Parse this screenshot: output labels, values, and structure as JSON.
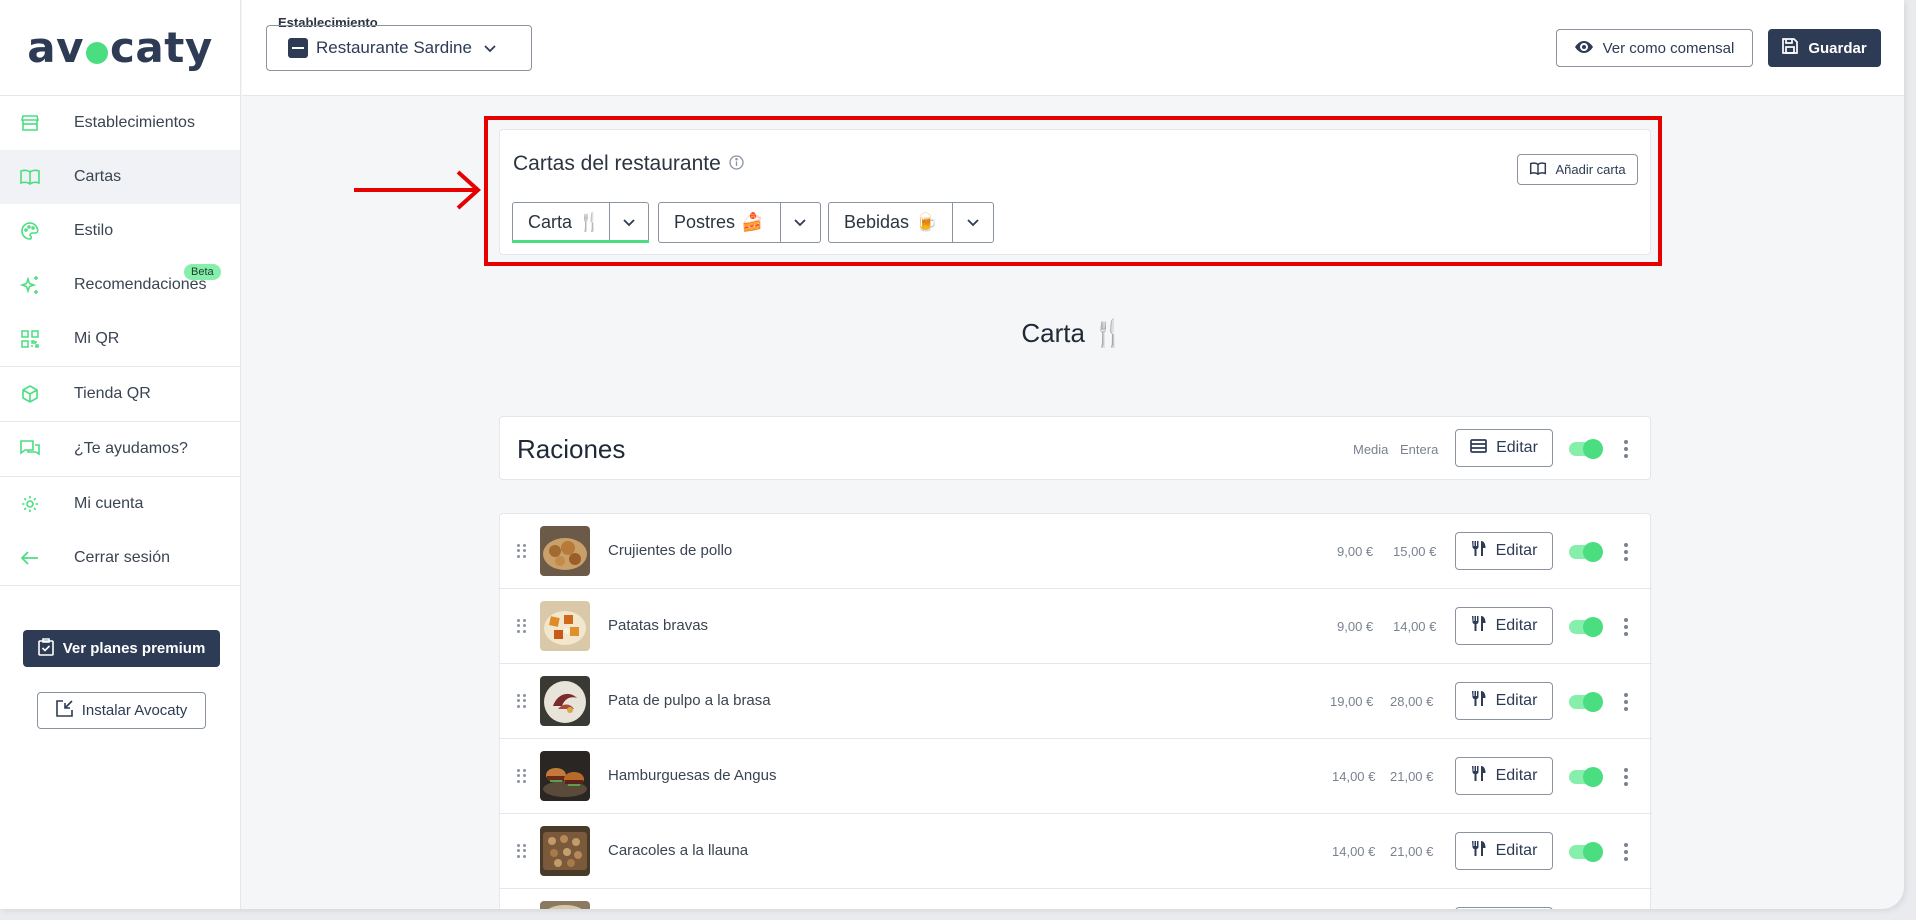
{
  "logo": {
    "text_left": "av",
    "text_right": "caty"
  },
  "topbar": {
    "establishment_legend": "Establecimiento",
    "establishment_value": "Restaurante Sardine",
    "view_as_diner": "Ver como comensal",
    "save": "Guardar"
  },
  "sidebar": {
    "items": [
      {
        "label": "Establecimientos",
        "icon": "store-icon"
      },
      {
        "label": "Cartas",
        "icon": "book-icon"
      },
      {
        "label": "Estilo",
        "icon": "palette-icon"
      },
      {
        "label": "Recomendaciones",
        "icon": "sparkles-icon",
        "badge": "Beta"
      },
      {
        "label": "Mi QR",
        "icon": "qr-icon"
      },
      {
        "label": "Tienda QR",
        "icon": "box-icon"
      },
      {
        "label": "¿Te ayudamos?",
        "icon": "chat-icon"
      },
      {
        "label": "Mi cuenta",
        "icon": "gear-icon"
      },
      {
        "label": "Cerrar sesión",
        "icon": "arrow-left-icon"
      }
    ],
    "premium": "Ver planes premium",
    "install": "Instalar Avocaty"
  },
  "cartas": {
    "title": "Cartas del restaurante",
    "add": "Añadir carta",
    "tabs": [
      {
        "label": "Carta",
        "emoji": "🍴"
      },
      {
        "label": "Postres",
        "emoji": "🍰"
      },
      {
        "label": "Bebidas",
        "emoji": "🍺"
      }
    ]
  },
  "current_menu": {
    "title": "Carta",
    "emoji": "🍴"
  },
  "section": {
    "title": "Raciones",
    "col_half": "Media",
    "col_full": "Entera",
    "edit": "Editar"
  },
  "dishes": [
    {
      "name": "Crujientes de pollo",
      "half": "9,00 €",
      "full": "15,00 €",
      "edit": "Editar"
    },
    {
      "name": "Patatas bravas",
      "half": "9,00 €",
      "full": "14,00 €",
      "edit": "Editar"
    },
    {
      "name": "Pata de pulpo a la brasa",
      "half": "19,00 €",
      "full": "28,00 €",
      "edit": "Editar"
    },
    {
      "name": "Hamburguesas de Angus",
      "half": "14,00 €",
      "full": "21,00 €",
      "edit": "Editar"
    },
    {
      "name": "Caracoles a la llauna",
      "half": "14,00 €",
      "full": "21,00 €",
      "edit": "Editar"
    }
  ],
  "colors": {
    "accent_green": "#4ade80",
    "navy": "#2e3b55",
    "highlight_red": "#e60000"
  }
}
